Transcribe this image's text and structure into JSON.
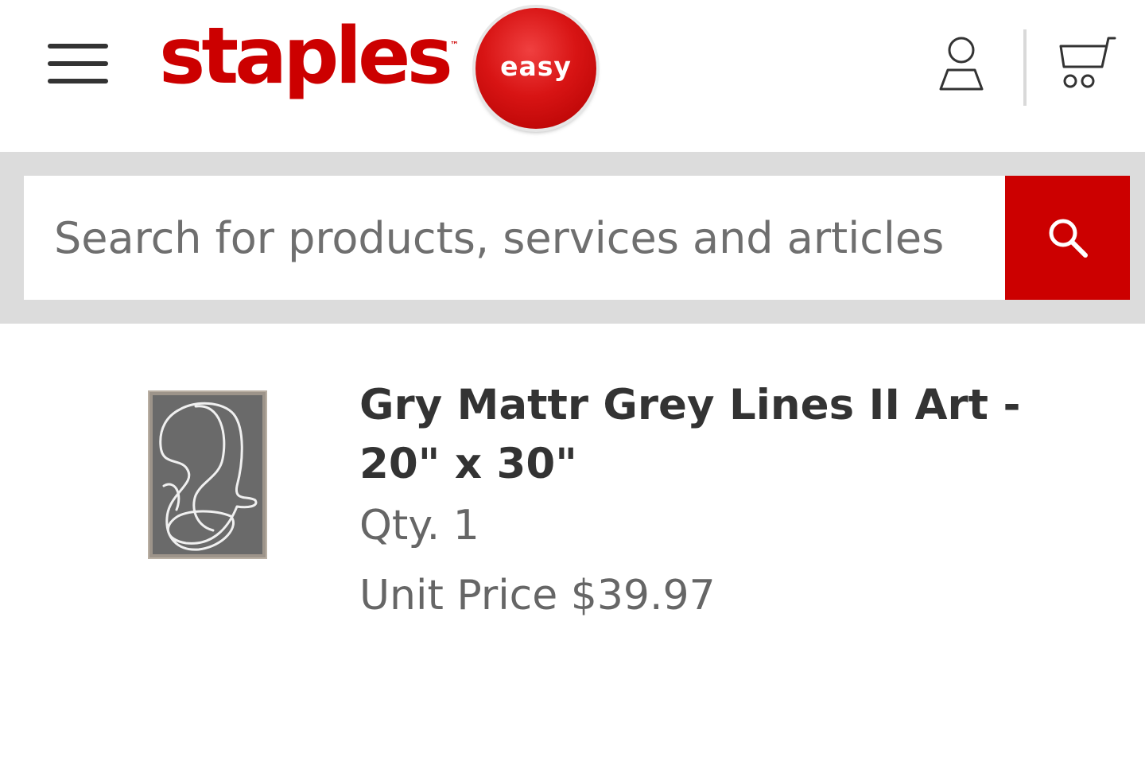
{
  "header": {
    "menu_icon": "hamburger-menu-icon",
    "logo_text": "staples",
    "logo_trademark": "™",
    "easy_button_label": "easy",
    "account_icon": "user-account-icon",
    "cart_icon": "shopping-cart-icon"
  },
  "search": {
    "placeholder": "Search for products, services and articles",
    "value": "",
    "button_icon": "search-icon"
  },
  "product": {
    "image_alt_icon": "framed-art-line-drawing-image",
    "title": "Gry Mattr Grey Lines II Art - 20\" x 30\"",
    "qty": "Qty. 1",
    "unit_price": "Unit Price $39.97"
  },
  "colors": {
    "brand_red": "#cc0000",
    "text_dark": "#333333",
    "text_muted": "#666666",
    "search_band": "#dcdcdc"
  }
}
